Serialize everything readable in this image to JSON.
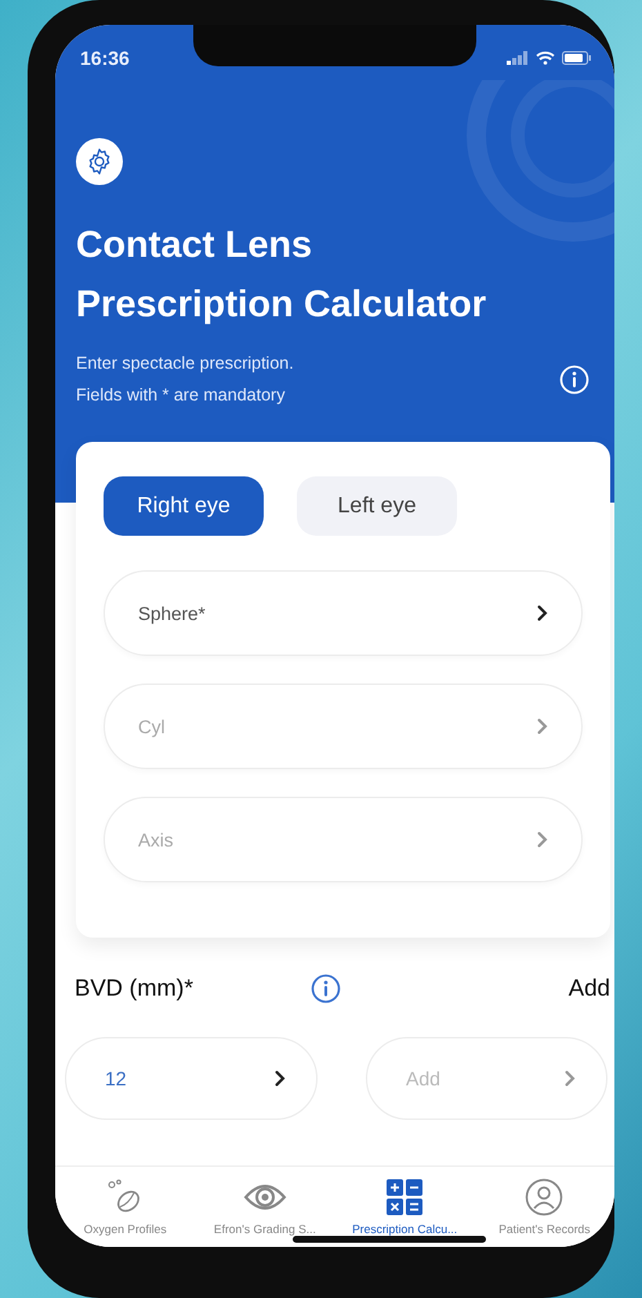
{
  "status_bar": {
    "time": "16:36"
  },
  "header": {
    "title": "Contact Lens Prescription Calculator",
    "subtitle_lines": [
      "Enter spectacle prescription.",
      "Fields with * are mandatory"
    ]
  },
  "eye_tabs": [
    {
      "label": "Right eye",
      "selected": true
    },
    {
      "label": "Left eye",
      "selected": false
    }
  ],
  "fields": [
    {
      "placeholder": "Sphere*",
      "mandatory": true
    },
    {
      "placeholder": "Cyl",
      "mandatory": false
    },
    {
      "placeholder": "Axis",
      "mandatory": false
    }
  ],
  "bvd": {
    "label": "BVD (mm)*",
    "action": "Add",
    "fields": [
      {
        "value": "12"
      },
      {
        "placeholder": "Add"
      }
    ]
  },
  "tab_bar": [
    {
      "kind": "lens",
      "label": "Oxygen Profiles",
      "selected": false
    },
    {
      "kind": "eye",
      "label": "Efron's Grading S...",
      "selected": false
    },
    {
      "kind": "calculator",
      "label": "Prescription Calcu...",
      "selected": true
    },
    {
      "kind": "person",
      "label": "Patient's Records",
      "selected": false
    }
  ]
}
